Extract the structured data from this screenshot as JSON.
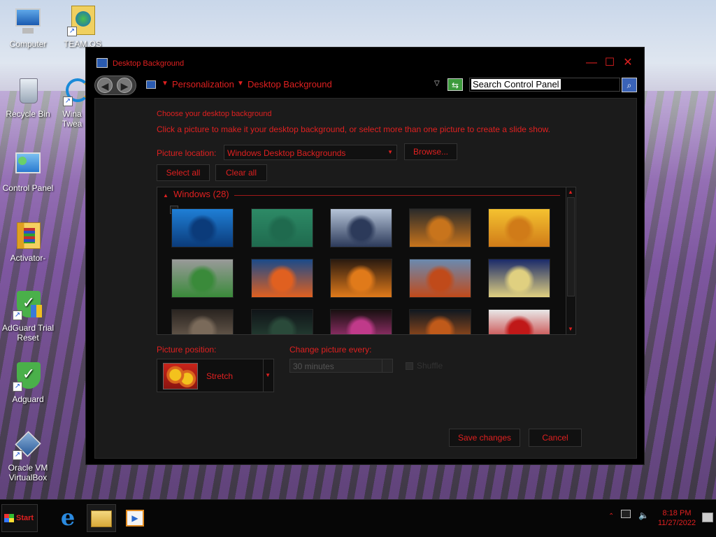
{
  "desktop": {
    "icons": [
      {
        "label": "Computer",
        "icon": "computer-icon"
      },
      {
        "label": "TEAM OS",
        "icon": "team-os-icon"
      },
      {
        "label": "Recycle Bin",
        "icon": "recycle-bin-icon"
      },
      {
        "label": "Wina Twea",
        "icon": "winaero-tweaker-icon"
      },
      {
        "label": "Control Panel",
        "icon": "control-panel-icon"
      },
      {
        "label": "Activator-",
        "icon": "folder-icon"
      },
      {
        "label": "AdGuard Trial Reset",
        "icon": "adguard-reset-icon"
      },
      {
        "label": "Adguard",
        "icon": "adguard-icon"
      },
      {
        "label": "Oracle VM VirtualBox",
        "icon": "virtualbox-icon"
      }
    ]
  },
  "window": {
    "title": "Desktop Background",
    "minimize": "—",
    "maximize": "☐",
    "close": "✕"
  },
  "navbar": {
    "back": "◀",
    "forward": "▶",
    "breadcrumb": [
      "Personalization",
      "Desktop Background"
    ],
    "search_placeholder": "Search Control Panel"
  },
  "content": {
    "heading": "Choose your desktop background",
    "description": "Click a picture to make it your desktop background, or select more than one picture to create a slide show.",
    "picture_location_label": "Picture location:",
    "picture_location_value": "Windows Desktop Backgrounds",
    "browse_label": "Browse...",
    "select_all_label": "Select all",
    "clear_all_label": "Clear all",
    "group_label": "Windows (28)",
    "picture_position_label": "Picture position:",
    "picture_position_value": "Stretch",
    "change_every_label": "Change picture every:",
    "change_every_value": "30 minutes",
    "shuffle_label": "Shuffle",
    "save_label": "Save changes",
    "cancel_label": "Cancel"
  },
  "thumbnails": [
    {
      "name": "windows-logo-wallpaper",
      "colors": [
        "#1f7fd6",
        "#0b3b7a"
      ]
    },
    {
      "name": "green-skull-wallpaper",
      "colors": [
        "#2d8a66",
        "#1f6a4e"
      ]
    },
    {
      "name": "mushroom-cloud-blue",
      "colors": [
        "#b6c4d8",
        "#2c3a5a"
      ]
    },
    {
      "name": "hallo-skull-explosion",
      "colors": [
        "#2a2a2a",
        "#c8741c"
      ]
    },
    {
      "name": "yellow-mushroom-cloud",
      "colors": [
        "#f4c230",
        "#d07b18"
      ]
    },
    {
      "name": "green-skull-tree",
      "colors": [
        "#9a9a9a",
        "#3a8a3a"
      ]
    },
    {
      "name": "earth-explosion",
      "colors": [
        "#1a4a8a",
        "#e06020"
      ]
    },
    {
      "name": "orange-mushroom-cloud",
      "colors": [
        "#2a1a10",
        "#e07a1a"
      ]
    },
    {
      "name": "mushroom-cloud-sky",
      "colors": [
        "#6a8ab0",
        "#c04a1a"
      ]
    },
    {
      "name": "night-mushroom-cloud",
      "colors": [
        "#1a2a6a",
        "#e0d080"
      ]
    },
    {
      "name": "dark-mushroom-cloud",
      "colors": [
        "#2a2420",
        "#7a6a5a"
      ]
    },
    {
      "name": "nuclear-explosions-since-1945",
      "colors": [
        "#101418",
        "#2a4a3a"
      ]
    },
    {
      "name": "rainbow-explosion",
      "colors": [
        "#181010",
        "#c03a8a"
      ]
    },
    {
      "name": "ocean-explosion",
      "colors": [
        "#101820",
        "#c05a1a"
      ]
    },
    {
      "name": "red-abstract",
      "colors": [
        "#e8e8e8",
        "#c01818"
      ]
    }
  ],
  "taskbar": {
    "start_label": "Start",
    "apps": [
      "internet-explorer-icon",
      "file-explorer-icon",
      "media-player-icon"
    ],
    "time": "8:18 PM",
    "date": "11/27/2022"
  }
}
